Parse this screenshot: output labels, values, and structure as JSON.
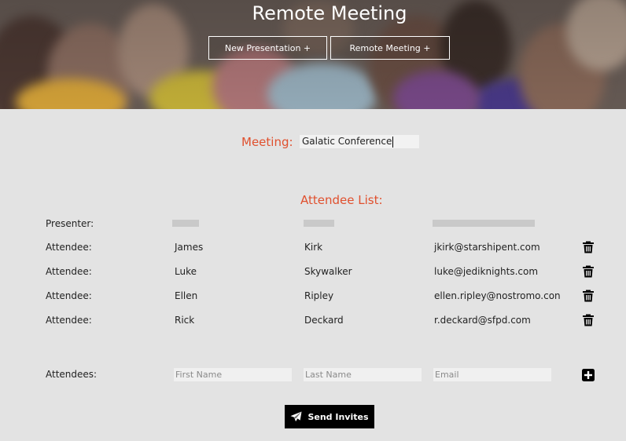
{
  "header": {
    "title": "Remote Meeting",
    "buttons": [
      {
        "label": "New Presentation +"
      },
      {
        "label": "Remote Meeting +"
      }
    ]
  },
  "meeting": {
    "label": "Meeting:",
    "value": "Galatic Conference"
  },
  "attendee_list": {
    "title": "Attendee List:",
    "presenter_label": "Presenter:",
    "rows": [
      {
        "role": "Attendee:",
        "first": "James",
        "last": "Kirk",
        "email": "jkirk@starshipent.com"
      },
      {
        "role": "Attendee:",
        "first": "Luke",
        "last": "Skywalker",
        "email": "luke@jediknights.com"
      },
      {
        "role": "Attendee:",
        "first": "Ellen",
        "last": "Ripley",
        "email": "ellen.ripley@nostromo.con"
      },
      {
        "role": "Attendee:",
        "first": "Rick",
        "last": "Deckard",
        "email": "r.deckard@sfpd.com"
      }
    ]
  },
  "add_attendee": {
    "label": "Attendees:",
    "first_placeholder": "First Name",
    "last_placeholder": "Last Name",
    "email_placeholder": "Email"
  },
  "send_button": {
    "label": "Send Invites"
  },
  "colors": {
    "accent": "#e0502e",
    "background": "#e3e3e3"
  },
  "icons": [
    "trash-icon",
    "plus-icon",
    "paper-plane-icon"
  ]
}
